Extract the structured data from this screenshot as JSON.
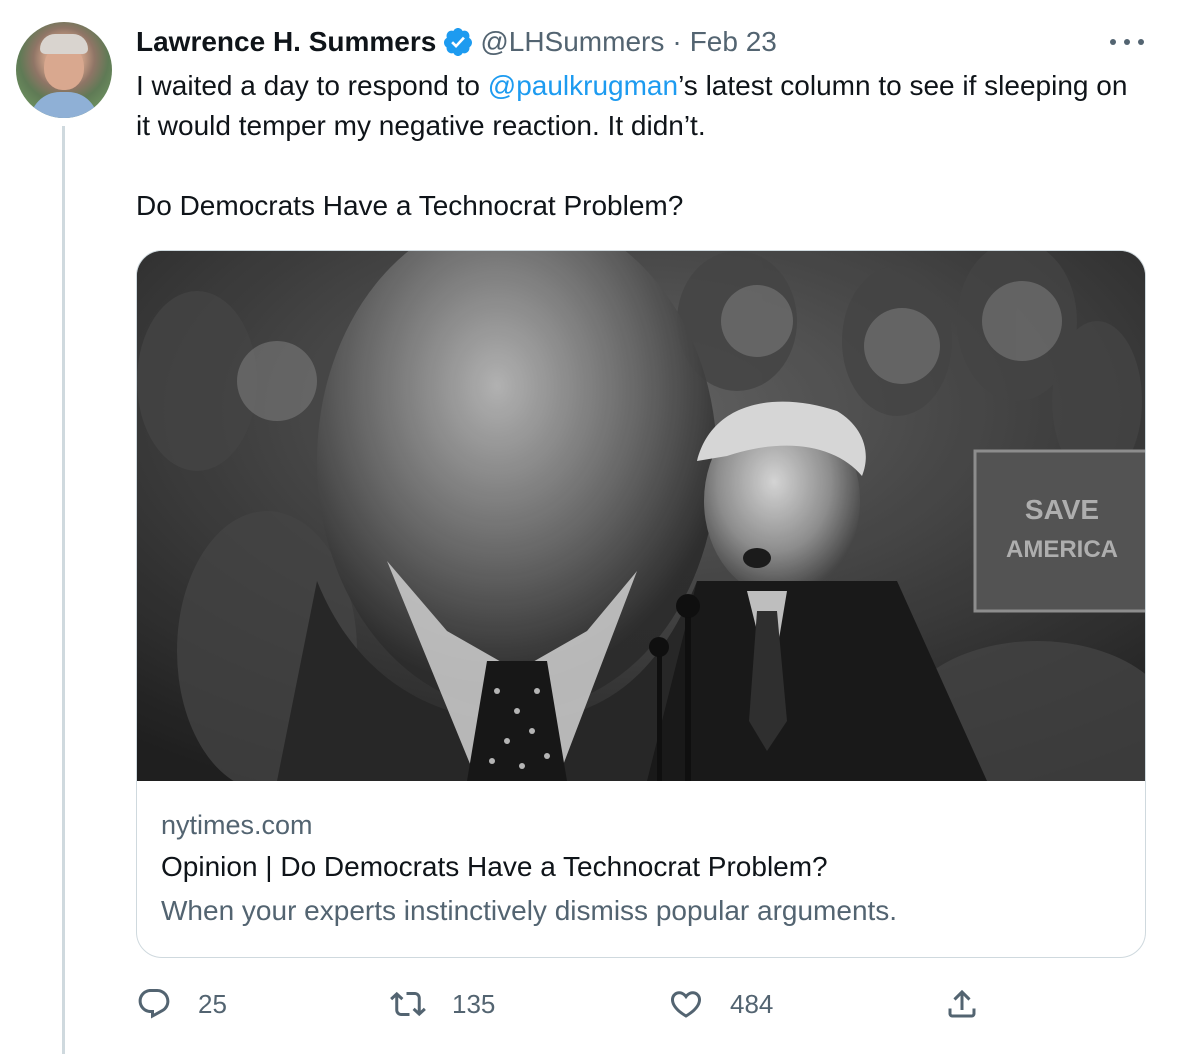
{
  "tweet": {
    "author_name": "Lawrence H. Summers",
    "handle": "@LHSummers",
    "separator": "·",
    "date": "Feb 23",
    "text_part1": "I waited a day to respond to ",
    "mention": "@paulkrugman",
    "text_part2": "’s latest column to see if sleeping on it would temper my negative reaction. It didn’t.",
    "text_line3": "Do Democrats Have a Technocrat Problem?"
  },
  "card": {
    "domain": "nytimes.com",
    "title": "Opinion | Do Democrats Have a Technocrat Problem?",
    "description": "When your experts instinctively dismiss popular arguments.",
    "sign_line1": "SAVE",
    "sign_line2": "AMERICA"
  },
  "actions": {
    "reply_count": "25",
    "retweet_count": "135",
    "like_count": "484"
  },
  "colors": {
    "accent": "#1d9bf0",
    "secondary_text": "#536471",
    "border": "#cfd9de"
  },
  "icons": {
    "verified": "verified-badge-icon",
    "more": "more-options-icon",
    "reply": "reply-icon",
    "retweet": "retweet-icon",
    "like": "heart-icon",
    "share": "share-icon"
  }
}
